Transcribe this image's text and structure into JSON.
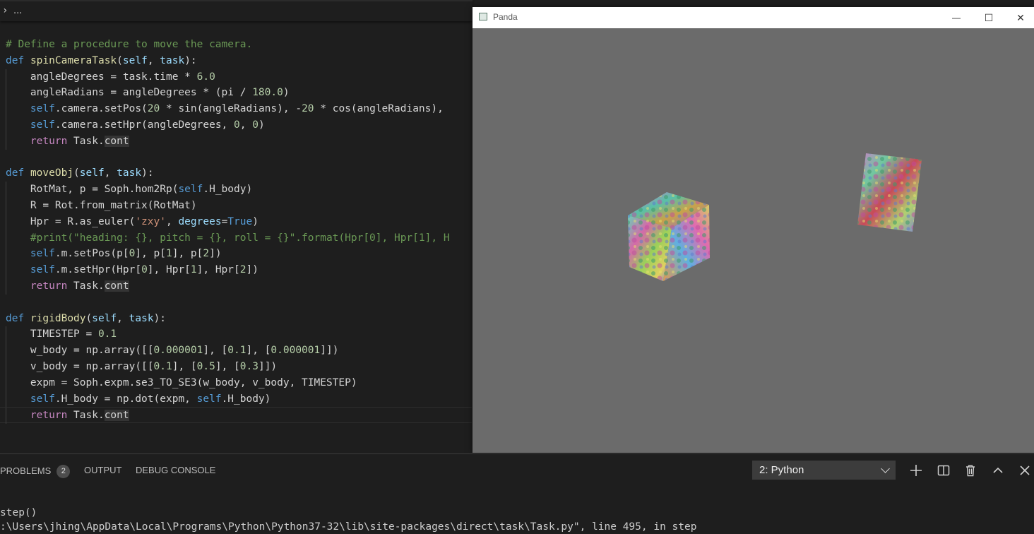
{
  "breadcrumb": {
    "chevron": "›",
    "ellipsis": "..."
  },
  "code_lines": [
    {
      "tokens": [
        {
          "c": "cm",
          "t": "# Define a procedure to move the camera."
        }
      ]
    },
    {
      "tokens": [
        {
          "c": "kw",
          "t": "def"
        },
        {
          "c": "",
          "t": " "
        },
        {
          "c": "fn",
          "t": "spinCameraTask"
        },
        {
          "c": "",
          "t": "("
        },
        {
          "c": "pm",
          "t": "self"
        },
        {
          "c": "",
          "t": ", "
        },
        {
          "c": "pm",
          "t": "task"
        },
        {
          "c": "",
          "t": "):"
        }
      ]
    },
    {
      "indent": true,
      "tokens": [
        {
          "c": "",
          "t": "    angleDegrees = task.time * "
        },
        {
          "c": "nm",
          "t": "6.0"
        }
      ]
    },
    {
      "indent": true,
      "tokens": [
        {
          "c": "",
          "t": "    angleRadians = angleDegrees * (pi / "
        },
        {
          "c": "nm",
          "t": "180.0"
        },
        {
          "c": "",
          "t": ")"
        }
      ]
    },
    {
      "indent": true,
      "tokens": [
        {
          "c": "",
          "t": "    "
        },
        {
          "c": "kw",
          "t": "self"
        },
        {
          "c": "",
          "t": ".camera.setPos("
        },
        {
          "c": "nm",
          "t": "20"
        },
        {
          "c": "",
          "t": " * sin(angleRadians), -"
        },
        {
          "c": "nm",
          "t": "20"
        },
        {
          "c": "",
          "t": " * cos(angleRadians),"
        }
      ]
    },
    {
      "indent": true,
      "tokens": [
        {
          "c": "",
          "t": "    "
        },
        {
          "c": "kw",
          "t": "self"
        },
        {
          "c": "",
          "t": ".camera.setHpr(angleDegrees, "
        },
        {
          "c": "nm",
          "t": "0"
        },
        {
          "c": "",
          "t": ", "
        },
        {
          "c": "nm",
          "t": "0"
        },
        {
          "c": "",
          "t": ")"
        }
      ]
    },
    {
      "indent": true,
      "tokens": [
        {
          "c": "",
          "t": "    "
        },
        {
          "c": "ctl",
          "t": "return"
        },
        {
          "c": "",
          "t": " Task."
        },
        {
          "c": "hl",
          "t": "cont"
        }
      ]
    },
    {
      "tokens": []
    },
    {
      "tokens": [
        {
          "c": "kw",
          "t": "def"
        },
        {
          "c": "",
          "t": " "
        },
        {
          "c": "fn",
          "t": "moveObj"
        },
        {
          "c": "",
          "t": "("
        },
        {
          "c": "pm",
          "t": "self"
        },
        {
          "c": "",
          "t": ", "
        },
        {
          "c": "pm",
          "t": "task"
        },
        {
          "c": "",
          "t": "):"
        }
      ]
    },
    {
      "indent": true,
      "tokens": [
        {
          "c": "",
          "t": "    RotMat, p = Soph.hom2Rp("
        },
        {
          "c": "kw",
          "t": "self"
        },
        {
          "c": "",
          "t": ".H_body)"
        }
      ]
    },
    {
      "indent": true,
      "tokens": [
        {
          "c": "",
          "t": "    R = Rot.from_matrix(RotMat)"
        }
      ]
    },
    {
      "indent": true,
      "tokens": [
        {
          "c": "",
          "t": "    Hpr = R.as_euler("
        },
        {
          "c": "st",
          "t": "'zxy'"
        },
        {
          "c": "",
          "t": ", "
        },
        {
          "c": "pm",
          "t": "degrees"
        },
        {
          "c": "",
          "t": "="
        },
        {
          "c": "kw",
          "t": "True"
        },
        {
          "c": "",
          "t": ")"
        }
      ]
    },
    {
      "indent": true,
      "tokens": [
        {
          "c": "",
          "t": "    "
        },
        {
          "c": "cm",
          "t": "#print(\"heading: {}, pitch = {}, roll = {}\".format(Hpr[0], Hpr[1], H"
        }
      ]
    },
    {
      "indent": true,
      "tokens": [
        {
          "c": "",
          "t": "    "
        },
        {
          "c": "kw",
          "t": "self"
        },
        {
          "c": "",
          "t": ".m.setPos(p["
        },
        {
          "c": "nm",
          "t": "0"
        },
        {
          "c": "",
          "t": "], p["
        },
        {
          "c": "nm",
          "t": "1"
        },
        {
          "c": "",
          "t": "], p["
        },
        {
          "c": "nm",
          "t": "2"
        },
        {
          "c": "",
          "t": "])"
        }
      ]
    },
    {
      "indent": true,
      "tokens": [
        {
          "c": "",
          "t": "    "
        },
        {
          "c": "kw",
          "t": "self"
        },
        {
          "c": "",
          "t": ".m.setHpr(Hpr["
        },
        {
          "c": "nm",
          "t": "0"
        },
        {
          "c": "",
          "t": "], Hpr["
        },
        {
          "c": "nm",
          "t": "1"
        },
        {
          "c": "",
          "t": "], Hpr["
        },
        {
          "c": "nm",
          "t": "2"
        },
        {
          "c": "",
          "t": "])"
        }
      ]
    },
    {
      "indent": true,
      "tokens": [
        {
          "c": "",
          "t": "    "
        },
        {
          "c": "ctl",
          "t": "return"
        },
        {
          "c": "",
          "t": " Task."
        },
        {
          "c": "hl",
          "t": "cont"
        }
      ]
    },
    {
      "tokens": []
    },
    {
      "tokens": [
        {
          "c": "kw",
          "t": "def"
        },
        {
          "c": "",
          "t": " "
        },
        {
          "c": "fn",
          "t": "rigidBody"
        },
        {
          "c": "",
          "t": "("
        },
        {
          "c": "pm",
          "t": "self"
        },
        {
          "c": "",
          "t": ", "
        },
        {
          "c": "pm",
          "t": "task"
        },
        {
          "c": "",
          "t": "):"
        }
      ]
    },
    {
      "indent": true,
      "tokens": [
        {
          "c": "",
          "t": "    TIMESTEP = "
        },
        {
          "c": "nm",
          "t": "0.1"
        }
      ]
    },
    {
      "indent": true,
      "tokens": [
        {
          "c": "",
          "t": "    w_body = np.array([["
        },
        {
          "c": "nm",
          "t": "0.000001"
        },
        {
          "c": "",
          "t": "], ["
        },
        {
          "c": "nm",
          "t": "0.1"
        },
        {
          "c": "",
          "t": "], ["
        },
        {
          "c": "nm",
          "t": "0.000001"
        },
        {
          "c": "",
          "t": "]])"
        }
      ]
    },
    {
      "indent": true,
      "tokens": [
        {
          "c": "",
          "t": "    v_body = np.array([["
        },
        {
          "c": "nm",
          "t": "0.1"
        },
        {
          "c": "",
          "t": "], ["
        },
        {
          "c": "nm",
          "t": "0.5"
        },
        {
          "c": "",
          "t": "], ["
        },
        {
          "c": "nm",
          "t": "0.3"
        },
        {
          "c": "",
          "t": "]])"
        }
      ]
    },
    {
      "indent": true,
      "tokens": [
        {
          "c": "",
          "t": "    expm = Soph.expm.se3_TO_SE3(w_body, v_body, TIMESTEP)"
        }
      ]
    },
    {
      "indent": true,
      "tokens": [
        {
          "c": "",
          "t": "    "
        },
        {
          "c": "kw",
          "t": "self"
        },
        {
          "c": "",
          "t": ".H_body = np.dot(expm, "
        },
        {
          "c": "kw",
          "t": "self"
        },
        {
          "c": "",
          "t": ".H_body)"
        }
      ]
    },
    {
      "indent": true,
      "current": true,
      "tokens": [
        {
          "c": "",
          "t": "    "
        },
        {
          "c": "ctl",
          "t": "return"
        },
        {
          "c": "",
          "t": " Task."
        },
        {
          "c": "hl",
          "t": "cont"
        }
      ]
    }
  ],
  "panda_window": {
    "title": "Panda",
    "minimize": "—",
    "maximize": "☐",
    "close": "✕"
  },
  "panel": {
    "tabs": [
      {
        "label": "PROBLEMS",
        "badge": "2"
      },
      {
        "label": "OUTPUT"
      },
      {
        "label": "DEBUG CONSOLE"
      }
    ],
    "terminal_select": "2: Python",
    "terminal_lines": [
      "step()",
      ":\\Users\\jhing\\AppData\\Local\\Programs\\Python\\Python37-32\\lib\\site-packages\\direct\\task\\Task.py\", line 495, in step"
    ]
  },
  "colors": {
    "accent": "#569cd6",
    "viewport": "#6b6b6b",
    "editor_bg": "#1e1e1e"
  }
}
